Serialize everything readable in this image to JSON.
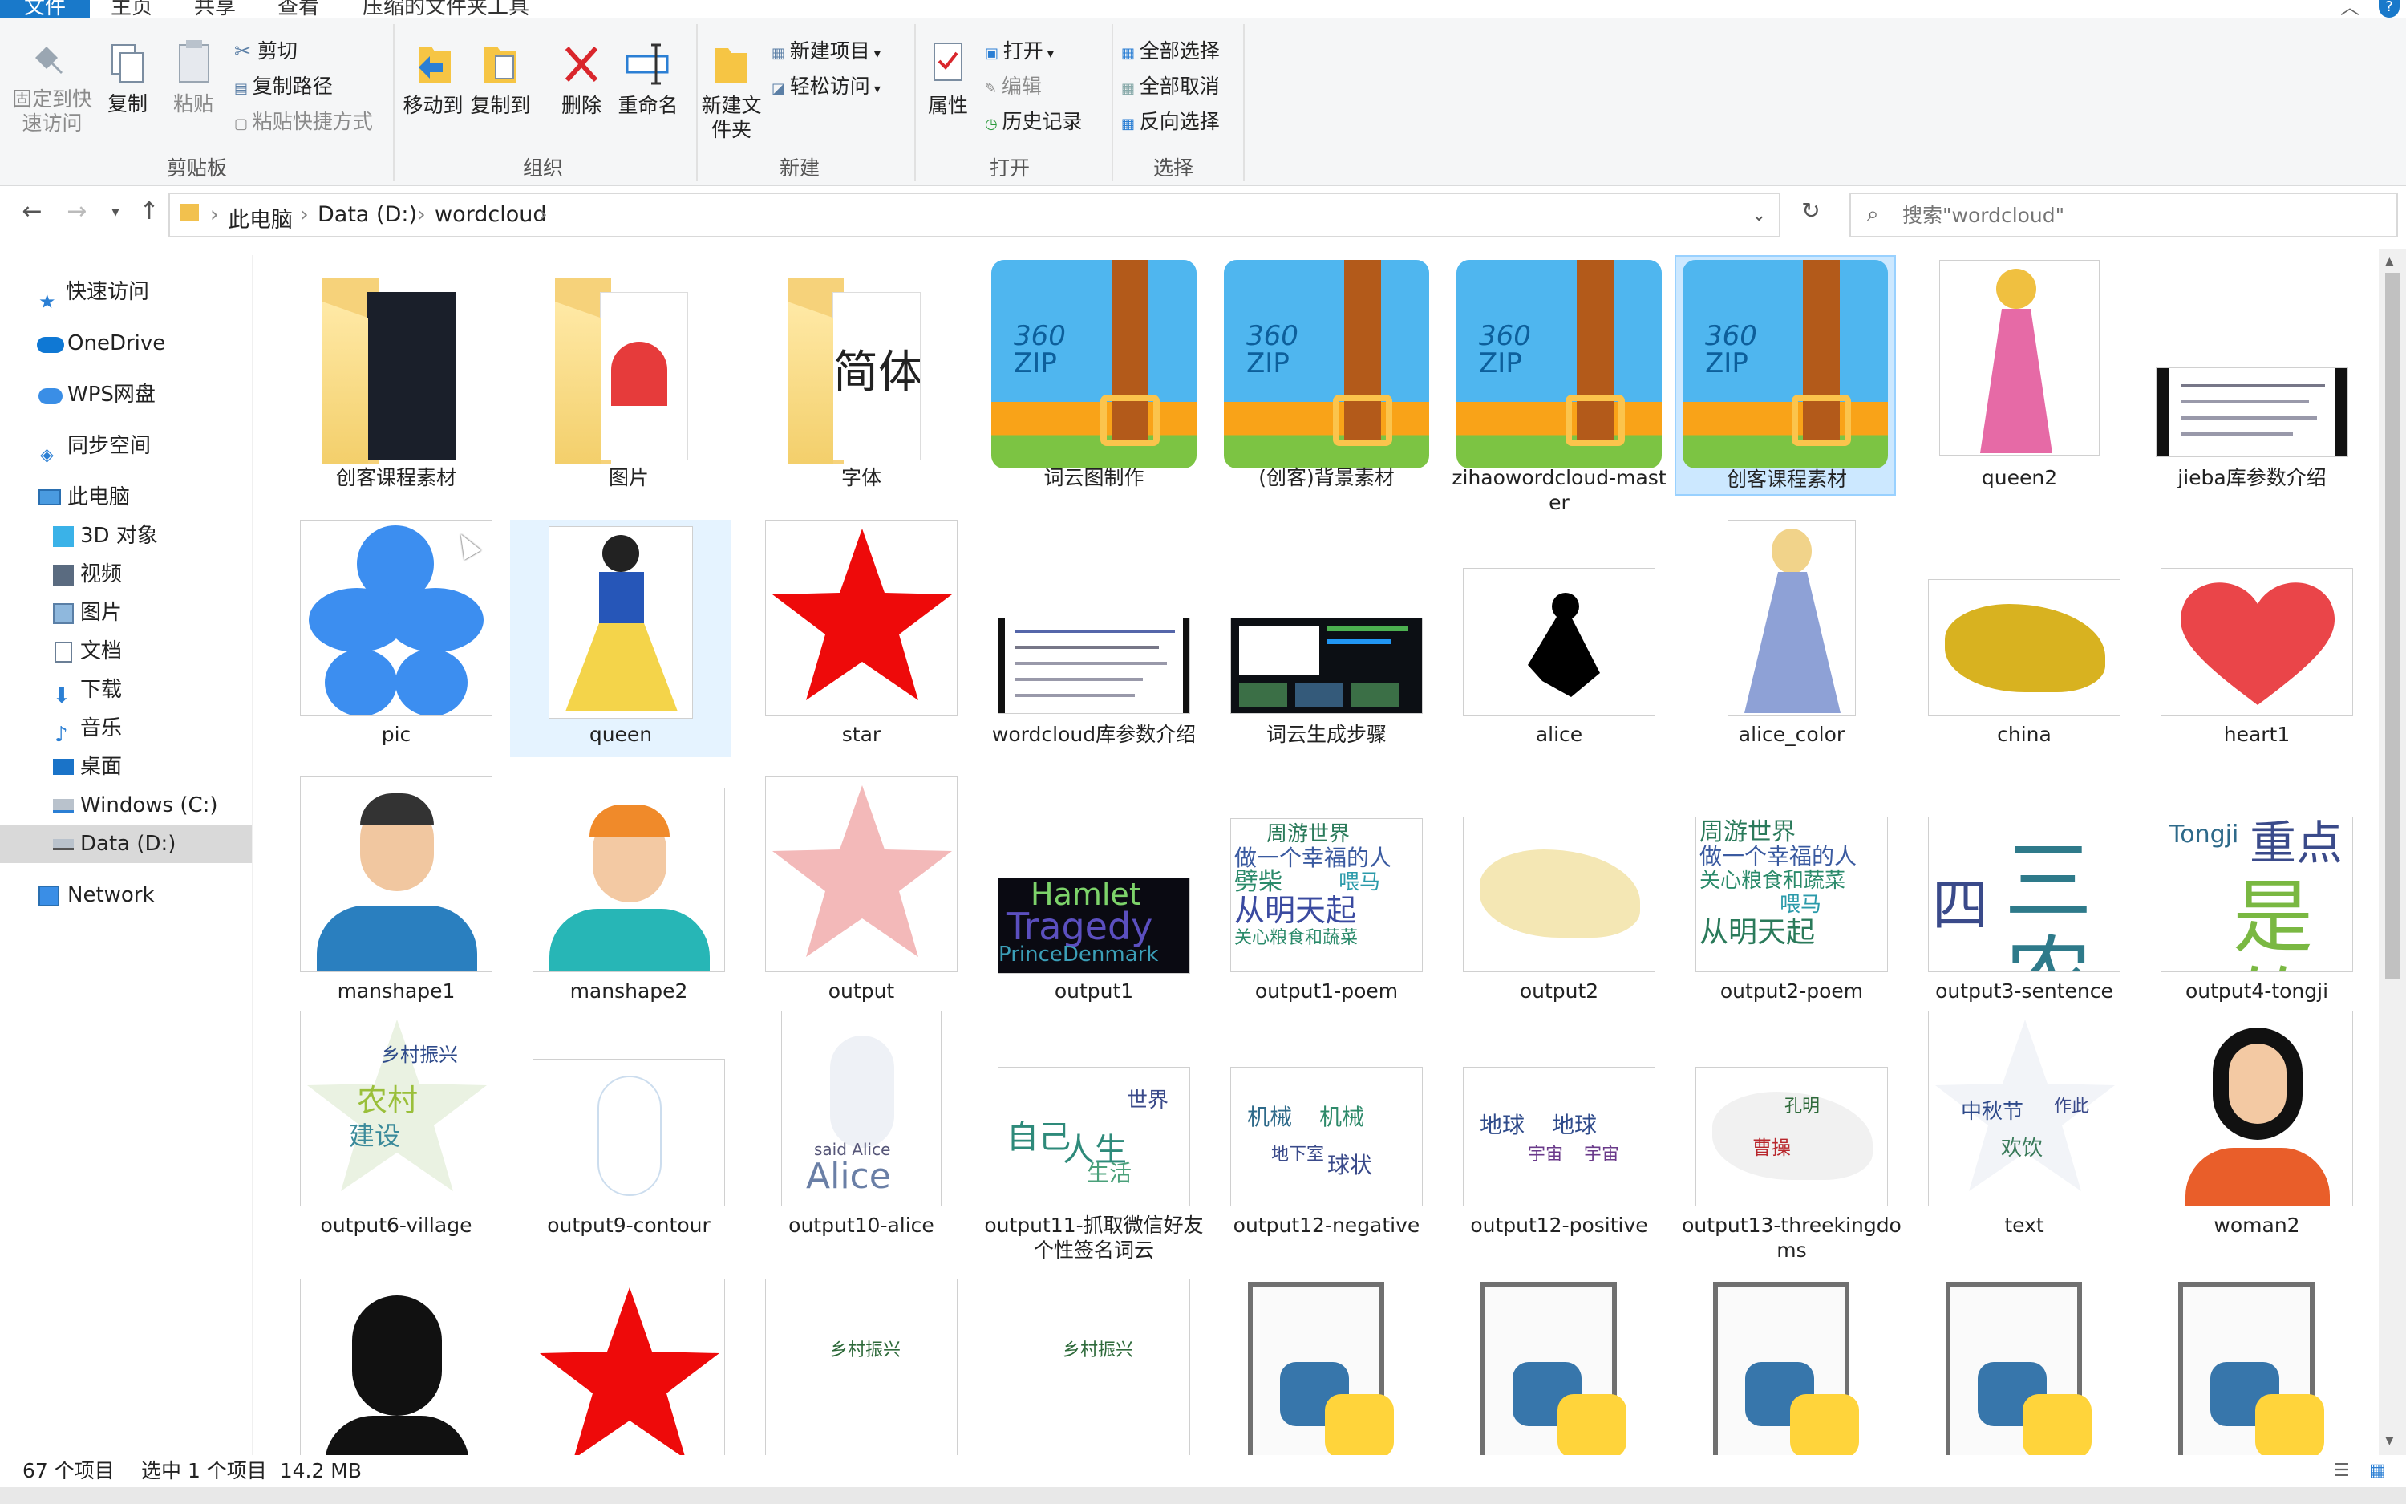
{
  "ribbon_tabs": {
    "file": "文件",
    "home": "主页",
    "share": "共享",
    "view": "查看",
    "compressed": "压缩的文件夹工具"
  },
  "ribbon": {
    "pin": "固定到快速访问",
    "copy": "复制",
    "paste": "粘贴",
    "cut": "剪切",
    "copy_path": "复制路径",
    "paste_shortcut": "粘贴快捷方式",
    "group_clipboard": "剪贴板",
    "move_to": "移动到",
    "copy_to": "复制到",
    "delete": "删除",
    "rename": "重命名",
    "group_organize": "组织",
    "new_folder": "新建文件夹",
    "new_item": "新建项目",
    "easy_access": "轻松访问",
    "group_new": "新建",
    "properties": "属性",
    "open": "打开",
    "edit": "编辑",
    "history": "历史记录",
    "group_open": "打开",
    "select_all": "全部选择",
    "select_none": "全部取消",
    "invert": "反向选择",
    "group_select": "选择"
  },
  "address": {
    "crumbs": [
      "此电脑",
      "Data (D:)",
      "wordcloud"
    ],
    "search_placeholder": "搜索\"wordcloud\""
  },
  "sidebar": [
    "快速访问",
    "OneDrive",
    "WPS网盘",
    "同步空间",
    "此电脑",
    "3D 对象",
    "视频",
    "图片",
    "文档",
    "下载",
    "音乐",
    "桌面",
    "Windows (C:)",
    "Data (D:)",
    "Network"
  ],
  "files": [
    "创客课程素材",
    "图片",
    "字体",
    "词云图制作",
    "(创客)背景素材",
    "zihaowordcloud-master",
    "创客课程素材",
    "queen2",
    "jieba库参数介绍",
    "pic",
    "queen",
    "star",
    "wordcloud库参数介绍",
    "词云生成步骤",
    "alice",
    "alice_color",
    "china",
    "heart1",
    "manshape1",
    "manshape2",
    "output",
    "output1",
    "output1-poem",
    "output2",
    "output2-poem",
    "output3-sentence",
    "output4-tongji",
    "output6-village",
    "output9-contour",
    "output10-alice",
    "output11-抓取微信好友个性签名词云",
    "output12-negative",
    "output12-positive",
    "output13-threekingdoms",
    "text",
    "woman2"
  ],
  "thumb_text": {
    "folder3": "简体",
    "zip_brand": "360",
    "zip_label": "ZIP",
    "output1_l1": "Hamlet",
    "output1_l2": "Tragedy",
    "output1_l3": "PrinceDenmark",
    "poem_l1": "周游世界",
    "poem_l2": "做一个幸福的人",
    "poem_l3": "劈柴",
    "poem_l4": "喂马",
    "poem_l5": "从明天起",
    "poem_l6": "关心粮食和蔬菜",
    "sent_l1": "三农",
    "sent_l2": "四",
    "tj_l1": "Tongji",
    "tj_l2": "重点",
    "tj_l3": "是的",
    "vil_l1": "乡村振兴",
    "vil_l2": "农村",
    "vil_l3": "建设",
    "alice_l1": "Alice",
    "alice_l2": "said Alice",
    "o11_l1": "自己",
    "o11_l2": "人生",
    "o11_l3": "世界",
    "o11_l4": "生活",
    "neg_l1": "机械",
    "neg_l2": "球状",
    "neg_l3": "地下室",
    "pos_l1": "地球",
    "pos_l2": "宇宙",
    "three_l1": "曹操",
    "three_l2": "孔明",
    "text_l1": "中秋节",
    "text_l2": "欢饮",
    "text_l3": "作此",
    "row5_l1": "乡村振兴"
  },
  "status": {
    "count": "67 个项目",
    "selection": "选中 1 个项目  14.2 MB"
  }
}
